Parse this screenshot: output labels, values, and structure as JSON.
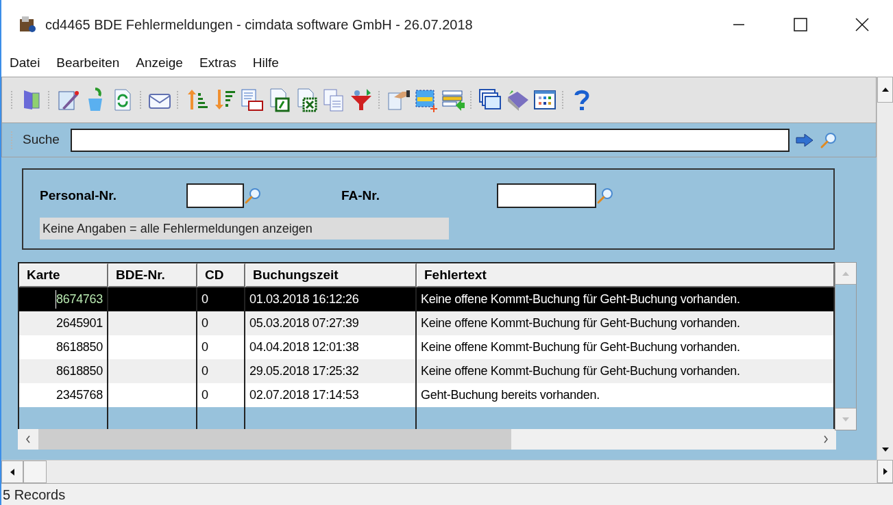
{
  "window": {
    "title": "cd4465 BDE Fehlermeldungen - cimdata software GmbH - 26.07.2018"
  },
  "menu": [
    "Datei",
    "Bearbeiten",
    "Anzeige",
    "Extras",
    "Hilfe"
  ],
  "search": {
    "label": "Suche"
  },
  "filter": {
    "fields": [
      {
        "label": "Personal-Nr."
      },
      {
        "label": "FA-Nr."
      }
    ],
    "hint": "Keine Angaben = alle Fehlermeldungen anzeigen"
  },
  "table": {
    "columns": [
      "Karte",
      "BDE-Nr.",
      "CD",
      "Buchungszeit",
      "Fehlertext"
    ],
    "rows": [
      {
        "selected": true,
        "cells": [
          "8674763",
          "",
          "0",
          "01.03.2018 16:12:26",
          "Keine offene Kommt-Buchung für Geht-Buchung vorhanden."
        ]
      },
      {
        "selected": false,
        "cells": [
          "2645901",
          "",
          "0",
          "05.03.2018 07:27:39",
          "Keine offene Kommt-Buchung für Geht-Buchung vorhanden."
        ]
      },
      {
        "selected": false,
        "cells": [
          "8618850",
          "",
          "0",
          "04.04.2018 12:01:38",
          "Keine offene Kommt-Buchung für Geht-Buchung vorhanden."
        ]
      },
      {
        "selected": false,
        "cells": [
          "8618850",
          "",
          "0",
          "29.05.2018 17:25:32",
          "Keine offene Kommt-Buchung für Geht-Buchung vorhanden."
        ]
      },
      {
        "selected": false,
        "cells": [
          "2345768",
          "",
          "0",
          "02.07.2018 17:14:53",
          "Geht-Buchung bereits vorhanden."
        ]
      }
    ]
  },
  "status_bar": "5 Records"
}
